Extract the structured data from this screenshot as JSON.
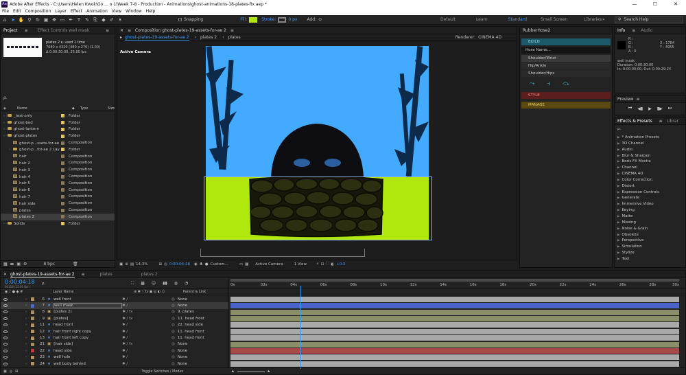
{
  "window": {
    "title": "Adobe After Effects - C:\\Users\\Helen Kwok\\Go ... o 1\\Week 7-8 - Production - Animations\\ghost-animations-18-plates-fix.aep *",
    "logo_text": "Ae",
    "controls": [
      "—",
      "☐",
      "✕"
    ]
  },
  "menu": [
    "File",
    "Edit",
    "Composition",
    "Layer",
    "Effect",
    "Animation",
    "View",
    "Window",
    "Help"
  ],
  "toolbar": {
    "snapping_label": "Snapping",
    "fill_label": "Fill:",
    "stroke_label": "Stroke:",
    "stroke_px": "0 px",
    "add_label": "Add:",
    "workspaces": [
      "Default",
      "Learn",
      "Standard",
      "Small Screen",
      "Libraries"
    ],
    "active_workspace": "Standard",
    "search_placeholder": "Search Help"
  },
  "project": {
    "tab_project": "Project",
    "tab_effect_controls": "Effect Controls well mask",
    "thumb_info": {
      "name": "plates 2 ▾, used 1 time",
      "line1": "7680 x 4320 (480 x 270) (1.00)",
      "line2": "Δ 0:00:30:00, 25.00 fps"
    },
    "search_placeholder": "ρ.",
    "col_name": "Name",
    "col_type": "Type",
    "col_size": "Size",
    "items": [
      {
        "name": "_test-only",
        "type": "Folder",
        "kind": "folder",
        "indent": 0,
        "label": "#e6c84a"
      },
      {
        "name": "ghost-bed",
        "type": "Folder",
        "kind": "folder",
        "indent": 0,
        "label": "#e6c84a"
      },
      {
        "name": "ghost-lantern",
        "type": "Folder",
        "kind": "folder",
        "indent": 0,
        "label": "#e6c84a"
      },
      {
        "name": "ghost-plates",
        "type": "Folder",
        "kind": "folder",
        "indent": 0,
        "label": "#e6c84a"
      },
      {
        "name": "ghost-p...ssets-for-ae 2",
        "type": "Composition",
        "kind": "comp",
        "indent": 1,
        "label": "#8a7a5a"
      },
      {
        "name": "ghost-p...for-ae 2 Layers",
        "type": "Folder",
        "kind": "folder",
        "indent": 1,
        "label": "#e6c84a"
      },
      {
        "name": "hair",
        "type": "Composition",
        "kind": "comp",
        "indent": 1,
        "label": "#8a7a5a"
      },
      {
        "name": "hair 2",
        "type": "Composition",
        "kind": "comp",
        "indent": 1,
        "label": "#8a7a5a"
      },
      {
        "name": "hair 3",
        "type": "Composition",
        "kind": "comp",
        "indent": 1,
        "label": "#8a7a5a"
      },
      {
        "name": "hair 4",
        "type": "Composition",
        "kind": "comp",
        "indent": 1,
        "label": "#8a7a5a"
      },
      {
        "name": "hair 5",
        "type": "Composition",
        "kind": "comp",
        "indent": 1,
        "label": "#8a7a5a"
      },
      {
        "name": "hair 6",
        "type": "Composition",
        "kind": "comp",
        "indent": 1,
        "label": "#8a7a5a"
      },
      {
        "name": "hair 7",
        "type": "Composition",
        "kind": "comp",
        "indent": 1,
        "label": "#8a7a5a"
      },
      {
        "name": "hair side",
        "type": "Composition",
        "kind": "comp",
        "indent": 1,
        "label": "#8a7a5a"
      },
      {
        "name": "plates",
        "type": "Composition",
        "kind": "comp",
        "indent": 1,
        "label": "#8a7a5a"
      },
      {
        "name": "plates 2",
        "type": "Composition",
        "kind": "comp",
        "indent": 1,
        "label": "#8a7a5a",
        "selected": true
      },
      {
        "name": "Solids",
        "type": "Folder",
        "kind": "folder",
        "indent": 0,
        "label": "#e6c84a"
      }
    ],
    "bpc": "8 bpc"
  },
  "composition": {
    "panel_title": "Composition ghost-plates-19-assets-for-ae 2",
    "tabs": [
      "ghost-plates-19-assets-for-ae 2",
      "plates 2",
      "plates"
    ],
    "renderer_label": "Renderer:",
    "renderer_value": "CINEMA 4D",
    "active_camera": "Active Camera",
    "footer": {
      "zoom": "14.3%",
      "timecode": "0:00:04:18",
      "resolution": "Custom...",
      "view": "Active Camera",
      "views": "1 View",
      "exposure": "+0.0"
    }
  },
  "rubberhose": {
    "title": "RubberHose2",
    "build": "BUILD",
    "hose_name_placeholder": "Hose Name...",
    "options": [
      "Shoulder/Wrist",
      "Hip/Ankle",
      "Shoulder/Hips"
    ],
    "style": "STYLE",
    "manage": "MANAGE"
  },
  "info": {
    "tab_info": "Info",
    "tab_audio": "Audio",
    "r": "R :",
    "g": "G :",
    "b": "B :",
    "a": "A :  0",
    "x": "X : 1784",
    "y": "Y : 4955",
    "layer": "well mask",
    "duration": "Duration: 0:00:30:00",
    "in_out": "In: 0:00:00:00, Out: 0:00:29:24"
  },
  "preview": {
    "title": "Preview"
  },
  "effects": {
    "tab": "Effects & Presets",
    "tab2": "Librar",
    "search_placeholder": "ρ.",
    "categories": [
      "* Animation Presets",
      "3D Channel",
      "Audio",
      "Blur & Sharpen",
      "Boris FX Mocha",
      "Channel",
      "CINEMA 4D",
      "Color Correction",
      "Distort",
      "Expression Controls",
      "Generate",
      "Immersive Video",
      "Keying",
      "Matte",
      "Missing",
      "Noise & Grain",
      "Obsolete",
      "Perspective",
      "Simulation",
      "Stylize",
      "Text"
    ]
  },
  "timeline": {
    "tabs": [
      "ghost-plates-19-assets-for-ae 2",
      "plates",
      "plates 2"
    ],
    "timecode": "0:00:04:18",
    "timecode_sub": "00118 (25.00 fps)",
    "search_placeholder": "ρ.",
    "col_layer_name": "Layer Name",
    "col_parent": "Parent & Link",
    "footer_label": "Toggle Switches / Modes",
    "ruler": [
      "0s",
      "02s",
      "04s",
      "06s",
      "08s",
      "10s",
      "12s",
      "14s",
      "16s",
      "18s",
      "20s",
      "22s",
      "24s",
      "26s",
      "28s",
      "30s"
    ],
    "playhead_sec": 4.72,
    "duration_sec": 30,
    "layers": [
      {
        "num": "6",
        "name": "well front",
        "parent": "None",
        "color": "#a8a8a8",
        "type": "shape",
        "label": "#b9925b"
      },
      {
        "num": "7",
        "name": "well mask",
        "parent": "None",
        "color": "#4a63c8",
        "type": "shape",
        "label": "#4a6cc8",
        "selected": true
      },
      {
        "num": "8",
        "name": "[plates 2]",
        "parent": "9. plates",
        "color": "#8a8f6a",
        "type": "comp",
        "label": "#a89060"
      },
      {
        "num": "9",
        "name": "[plates]",
        "parent": "11. head front",
        "color": "#8a8f6a",
        "type": "comp",
        "label": "#a89060"
      },
      {
        "num": "11",
        "name": "head front",
        "parent": "22. head side",
        "color": "#a8a8a8",
        "type": "shape",
        "label": "#b9925b"
      },
      {
        "num": "12",
        "name": "hair front right copy",
        "parent": "11. head front",
        "color": "#a8a8a8",
        "type": "shape",
        "label": "#b9925b"
      },
      {
        "num": "13",
        "name": "hair front left copy",
        "parent": "11. head front",
        "color": "#a8a8a8",
        "type": "shape",
        "label": "#b9925b"
      },
      {
        "num": "21",
        "name": "[hair side]",
        "parent": "None",
        "color": "#8a8f6a",
        "type": "comp",
        "label": "#a89060"
      },
      {
        "num": "22",
        "name": "head side",
        "parent": "None",
        "color": "#a84a4a",
        "type": "shape",
        "label": "#c83a3a"
      },
      {
        "num": "23",
        "name": "well hole",
        "parent": "None",
        "color": "#a8a8a8",
        "type": "shape",
        "label": "#b9925b"
      },
      {
        "num": "24",
        "name": "well body behind",
        "parent": "None",
        "color": "#a8a8a8",
        "type": "shape",
        "label": "#b9925b"
      }
    ]
  },
  "colors": {
    "accent": "#3b9cff",
    "fill_swatch": "#b0e70c",
    "canvas_bg": "#42aaff"
  }
}
